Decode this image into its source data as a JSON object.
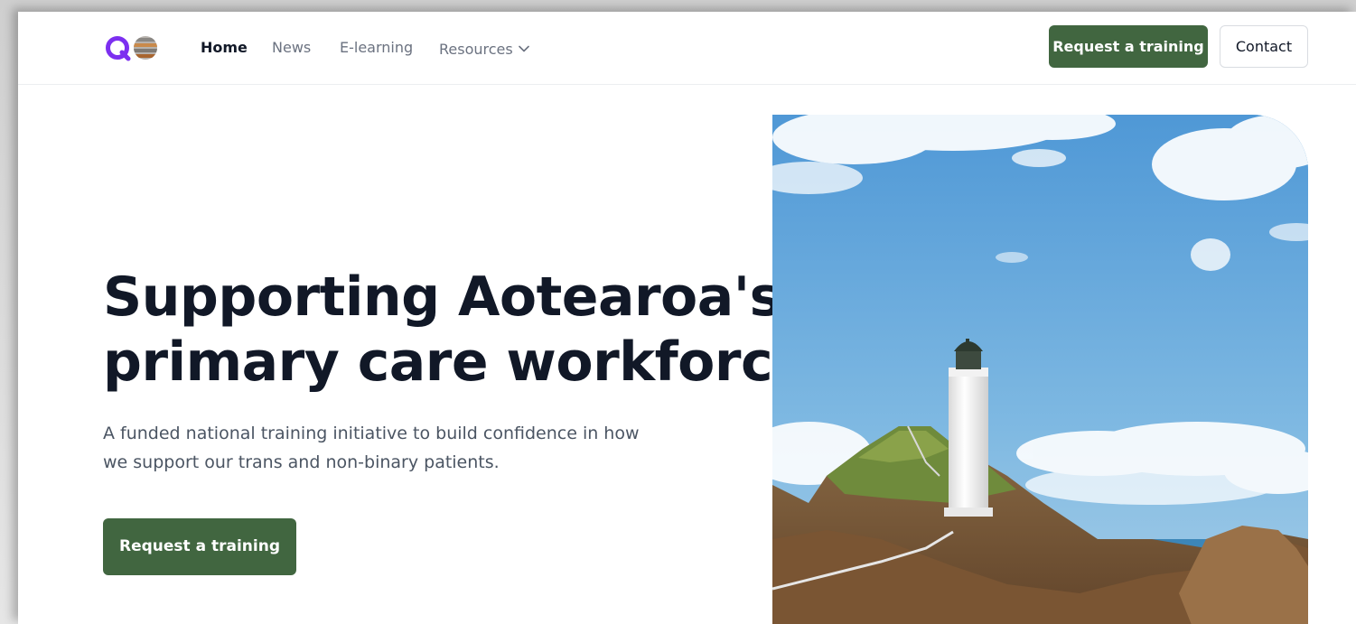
{
  "nav": {
    "links": [
      {
        "label": "Home",
        "active": true
      },
      {
        "label": "News",
        "active": false
      },
      {
        "label": "E-learning",
        "active": false
      },
      {
        "label": "Resources",
        "active": false,
        "has_dropdown": true
      }
    ],
    "cta_label": "Request a training",
    "contact_label": "Contact"
  },
  "hero": {
    "title_line1": "Supporting Aotearoa's",
    "title_line2": "primary care workforce.",
    "subtitle_line1": "A funded national training initiative to build confidence in how",
    "subtitle_line2": "we support our trans and non-binary patients.",
    "cta_label": "Request a training"
  },
  "icons": {
    "logo": "brand-logo-icon",
    "dropdown": "chevron-down-icon"
  },
  "colors": {
    "accent_green": "#416640",
    "logo_purple": "#7c2ff0",
    "heading": "#111827",
    "body_text": "#4b5563",
    "nav_inactive": "#6b7280"
  }
}
